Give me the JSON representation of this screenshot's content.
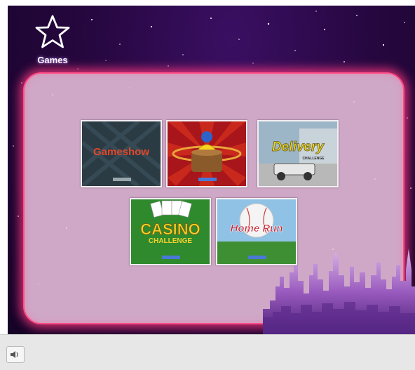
{
  "header": {
    "logo_label": "Games",
    "logo_icon": "star-outline-icon"
  },
  "games": [
    {
      "id": "gameshow",
      "title": "Gameshow"
    },
    {
      "id": "barrel"
    },
    {
      "id": "delivery",
      "title": "Delivery",
      "subtitle": "CHALLENGE"
    },
    {
      "id": "casino",
      "title": "CASINO",
      "subtitle": "CHALLENGE"
    },
    {
      "id": "homerun",
      "title": "Home Run"
    }
  ],
  "toolbar": {
    "sound_icon": "speaker-icon"
  },
  "colors": {
    "panel": "#cfa8c7",
    "panel_glow": "#ff4f86",
    "background": "#26073f",
    "bar": "#e7e7e7"
  }
}
